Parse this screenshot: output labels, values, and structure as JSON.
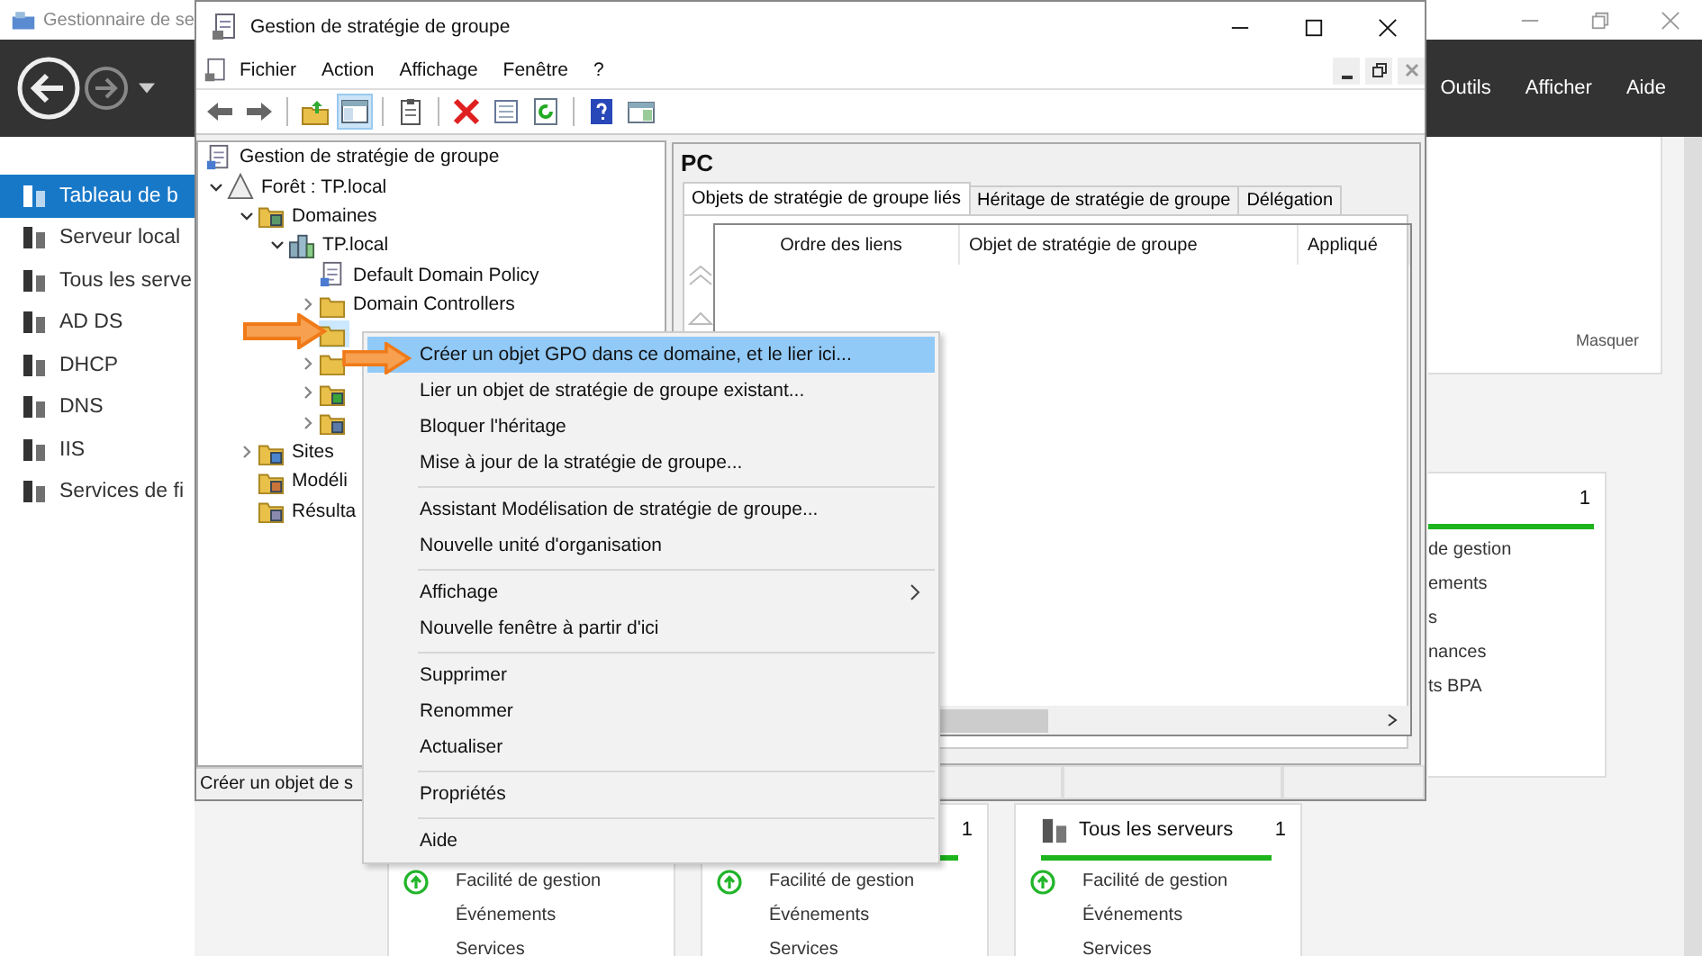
{
  "server_manager": {
    "title": "Gestionnaire de se",
    "menu": [
      "Outils",
      "Afficher",
      "Aide"
    ],
    "nav": [
      {
        "label": "Tableau de b",
        "selected": true
      },
      {
        "label": "Serveur local",
        "selected": false
      },
      {
        "label": "Tous les serve",
        "selected": false
      },
      {
        "label": "AD DS",
        "selected": false
      },
      {
        "label": "DHCP",
        "selected": false
      },
      {
        "label": "DNS",
        "selected": false
      },
      {
        "label": "IIS",
        "selected": false
      },
      {
        "label": "Services de fi",
        "selected": false
      }
    ],
    "hide_link": "Masquer",
    "side_tile": {
      "count": "1",
      "items": [
        {
          "label": "de gestion"
        },
        {
          "label": "ements"
        },
        {
          "label": "s"
        },
        {
          "label": "nances"
        },
        {
          "label": "ts BPA"
        }
      ]
    },
    "tiles": [
      {
        "items": [
          {
            "label": "Facilité de gestion",
            "ok": true
          },
          {
            "label": "Événements"
          },
          {
            "label": "Services"
          }
        ]
      },
      {
        "count": "1",
        "items": [
          {
            "label": "Facilité de gestion",
            "ok": true
          },
          {
            "label": "Événements"
          },
          {
            "label": "Services"
          }
        ]
      },
      {
        "title": "Tous les serveurs",
        "count": "1",
        "items": [
          {
            "label": "Facilité de gestion",
            "ok": true
          },
          {
            "label": "Événements"
          },
          {
            "label": "Services"
          }
        ]
      }
    ]
  },
  "gpmc": {
    "title": "Gestion de stratégie de groupe",
    "menu": [
      "Fichier",
      "Action",
      "Affichage",
      "Fenêtre",
      "?"
    ],
    "toolbar": [
      {
        "kind": "back",
        "pressed": false
      },
      {
        "kind": "forward",
        "pressed": false
      },
      {
        "kind": "up",
        "pressed": false
      },
      {
        "kind": "tree",
        "pressed": true
      },
      {
        "kind": "clipboard",
        "pressed": false
      },
      {
        "kind": "delete",
        "pressed": false
      },
      {
        "kind": "properties",
        "pressed": false
      },
      {
        "kind": "refresh",
        "pressed": false
      },
      {
        "kind": "help",
        "pressed": false
      },
      {
        "kind": "pane",
        "pressed": false
      }
    ],
    "tree": [
      {
        "label": "Gestion de stratégie de groupe",
        "kind": "root",
        "selected": false,
        "children": [
          {
            "label": "Forêt : TP.local",
            "kind": "forest",
            "selected": false,
            "expanded": true,
            "children": [
              {
                "label": "Domaines",
                "kind": "domains",
                "selected": false,
                "expanded": true,
                "children": [
                  {
                    "label": "TP.local",
                    "kind": "domain",
                    "selected": false,
                    "expanded": true,
                    "children": [
                      {
                        "label": "Default Domain Policy",
                        "kind": "gpo",
                        "selected": false
                      },
                      {
                        "label": "Domain Controllers",
                        "kind": "ou",
                        "selected": false,
                        "expanded": false
                      },
                      {
                        "kind": "ou",
                        "selected": true
                      },
                      {
                        "kind": "ou",
                        "selected": false,
                        "expanded": false
                      },
                      {
                        "kind": "filter",
                        "selected": false,
                        "expanded": false
                      },
                      {
                        "kind": "objects",
                        "selected": false,
                        "expanded": false
                      }
                    ]
                  }
                ]
              },
              {
                "label": "Sites",
                "kind": "sites",
                "selected": false,
                "expanded": false
              },
              {
                "label": "Modéli",
                "kind": "modeling",
                "selected": false
              },
              {
                "label": "Résulta",
                "kind": "results",
                "selected": false
              }
            ]
          }
        ]
      }
    ],
    "status": "Créer un objet de s",
    "pane_title": "PC",
    "tabs": [
      {
        "label": "Objets de stratégie de groupe liés",
        "selected": true
      },
      {
        "label": "Héritage de stratégie de groupe",
        "selected": false
      },
      {
        "label": "Délégation",
        "selected": false
      }
    ],
    "columns": [
      "Ordre des liens",
      "Objet de stratégie de groupe",
      "Appliqué"
    ]
  },
  "context_menu": [
    [
      {
        "label": "Créer un objet GPO dans ce domaine, et le lier ici...",
        "selected": true
      },
      {
        "label": "Lier un objet de stratégie de groupe existant...",
        "selected": false
      },
      {
        "label": "Bloquer l'héritage",
        "selected": false
      },
      {
        "label": "Mise à jour de la stratégie de groupe...",
        "selected": false
      }
    ],
    [
      {
        "label": "Assistant Modélisation de stratégie de groupe...",
        "selected": false
      },
      {
        "label": "Nouvelle unité d'organisation",
        "selected": false
      }
    ],
    [
      {
        "label": "Affichage",
        "selected": false,
        "submenu": true
      },
      {
        "label": "Nouvelle fenêtre à partir d'ici",
        "selected": false
      }
    ],
    [
      {
        "label": "Supprimer",
        "selected": false
      },
      {
        "label": "Renommer",
        "selected": false
      },
      {
        "label": "Actualiser",
        "selected": false
      }
    ],
    [
      {
        "label": "Propriétés",
        "selected": false
      }
    ],
    [
      {
        "label": "Aide",
        "selected": false
      }
    ]
  ]
}
